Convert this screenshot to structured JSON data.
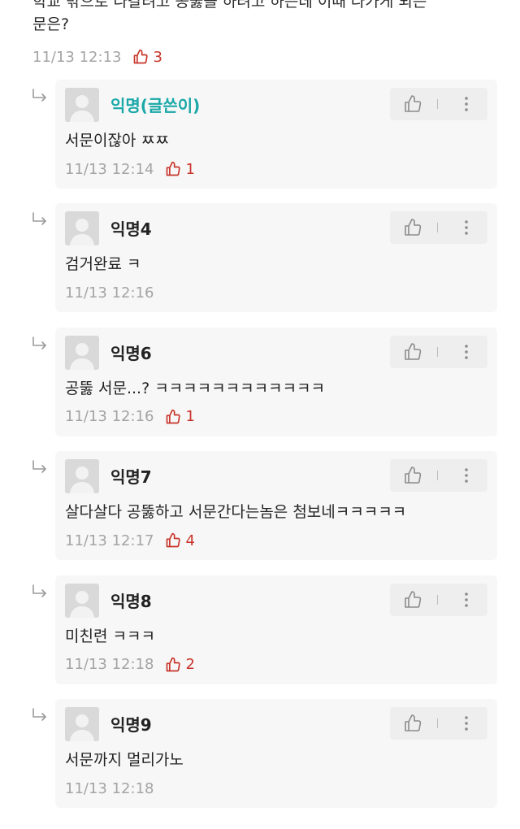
{
  "post": {
    "text": "학교 밖으로 나갈려고 공뚫을 하려고 하는데 이때 나가게 되는\n문은?",
    "time": "11/13 12:13",
    "likes": "3"
  },
  "colors": {
    "op_name": "#1aa8a8",
    "like": "#c8342a",
    "meta": "#a4a4a4",
    "card_bg": "#f7f7f7"
  },
  "icons": {
    "reply": "reply-arrow-icon",
    "like": "thumbs-up-icon",
    "more": "more-vertical-icon",
    "avatar": "default-avatar-icon"
  },
  "comments": [
    {
      "name": "익명(글쓴이)",
      "op": true,
      "text": "서문이잖아 ㅉㅉ",
      "time": "11/13 12:14",
      "likes": "1"
    },
    {
      "name": "익명4",
      "op": false,
      "text": "검거완료 ㅋ",
      "time": "11/13 12:16",
      "likes": ""
    },
    {
      "name": "익명6",
      "op": false,
      "text": "공뚫 서문...? ㅋㅋㅋㅋㅋㅋㅋㅋㅋㅋㅋㅋ",
      "time": "11/13 12:16",
      "likes": "1"
    },
    {
      "name": "익명7",
      "op": false,
      "text": "살다살다 공뚫하고 서문간다는놈은 첨보네ㅋㅋㅋㅋㅋ",
      "time": "11/13 12:17",
      "likes": "4"
    },
    {
      "name": "익명8",
      "op": false,
      "text": "미친련 ㅋㅋㅋ",
      "time": "11/13 12:18",
      "likes": "2"
    },
    {
      "name": "익명9",
      "op": false,
      "text": "서문까지 멀리가노",
      "time": "11/13 12:18",
      "likes": ""
    }
  ]
}
